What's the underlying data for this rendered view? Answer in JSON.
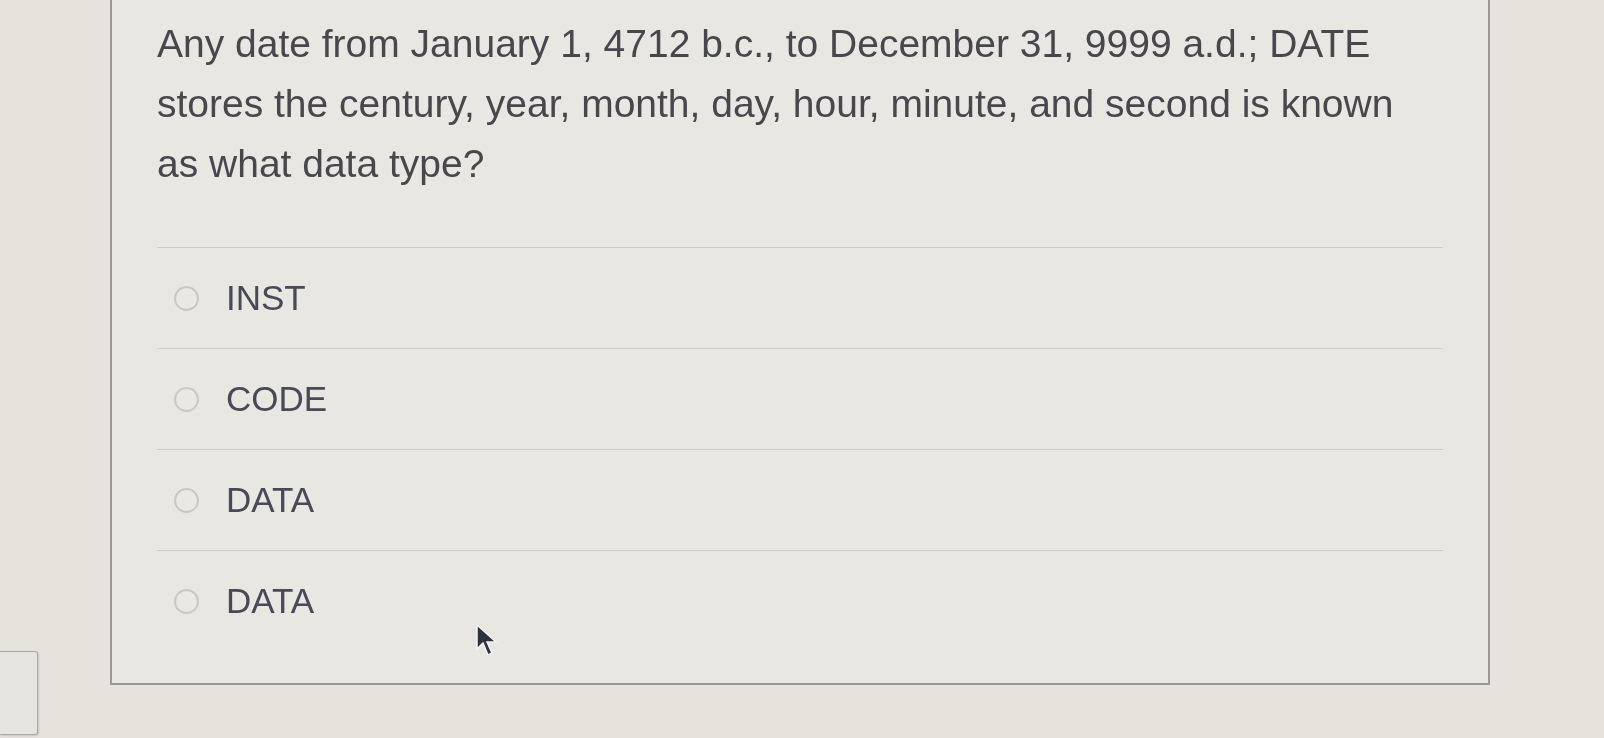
{
  "question": {
    "text": "Any date from January 1, 4712 b.c., to December 31, 9999 a.d.; DATE stores the century, year, month, day, hour, minute, and second is known as what data type?",
    "options": [
      {
        "label": "INST",
        "selected": false
      },
      {
        "label": "CODE",
        "selected": false
      },
      {
        "label": "DATA",
        "selected": false
      },
      {
        "label": "DATA",
        "selected": false
      }
    ]
  }
}
